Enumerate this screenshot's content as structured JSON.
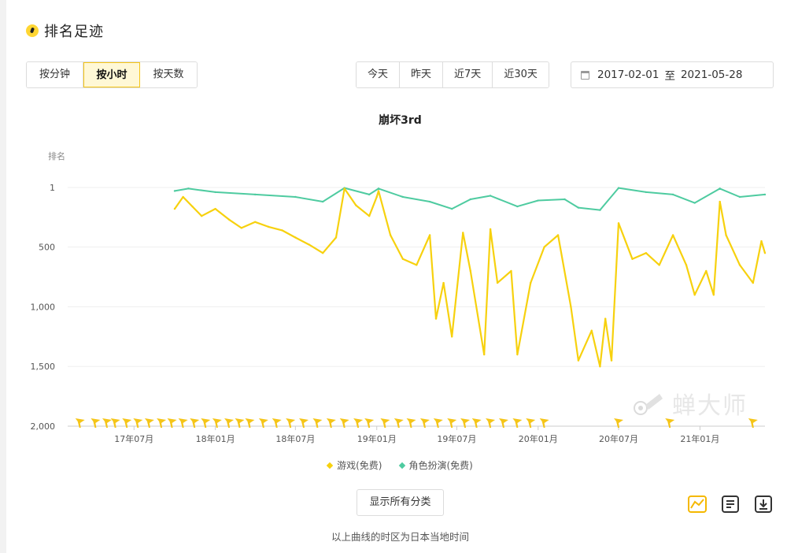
{
  "header": {
    "title": "排名足迹"
  },
  "granularity": {
    "options": [
      "按分钟",
      "按小时",
      "按天数"
    ],
    "active": 1
  },
  "quick_range": {
    "options": [
      "今天",
      "昨天",
      "近7天",
      "近30天"
    ]
  },
  "date_range": {
    "start": "2017-02-01",
    "separator": "至",
    "end": "2021-05-28"
  },
  "chart_data": {
    "type": "line",
    "title": "崩坏3rd",
    "ylabel": "排名",
    "yaxis": {
      "reversed": true,
      "ticks": [
        "1",
        "500",
        "1,000",
        "1,500",
        "2,000"
      ],
      "tick_values": [
        1,
        500,
        1000,
        1500,
        2000
      ],
      "range": [
        1,
        2000
      ]
    },
    "xaxis": {
      "ticks": [
        "17年07月",
        "18年01月",
        "18年07月",
        "19年01月",
        "19年07月",
        "20年01月",
        "20年07月",
        "21年01月"
      ],
      "tick_dates": [
        "2017-07-01",
        "2018-01-01",
        "2018-07-01",
        "2019-01-01",
        "2019-07-01",
        "2020-01-01",
        "2020-07-01",
        "2021-01-01"
      ],
      "range": [
        "2017-02-01",
        "2021-05-28"
      ]
    },
    "grid": true,
    "series": [
      {
        "name": "游戏(免费)",
        "color": "#f7d10e",
        "points": [
          [
            "2017-10-01",
            180
          ],
          [
            "2017-10-20",
            80
          ],
          [
            "2017-11-10",
            160
          ],
          [
            "2017-12-01",
            240
          ],
          [
            "2018-01-01",
            180
          ],
          [
            "2018-02-01",
            270
          ],
          [
            "2018-03-01",
            340
          ],
          [
            "2018-04-01",
            290
          ],
          [
            "2018-05-01",
            330
          ],
          [
            "2018-06-01",
            360
          ],
          [
            "2018-07-01",
            420
          ],
          [
            "2018-08-01",
            480
          ],
          [
            "2018-09-01",
            550
          ],
          [
            "2018-10-01",
            420
          ],
          [
            "2018-10-20",
            10
          ],
          [
            "2018-11-15",
            150
          ],
          [
            "2018-12-15",
            240
          ],
          [
            "2019-01-01",
            80
          ],
          [
            "2019-01-05",
            30
          ],
          [
            "2019-02-01",
            400
          ],
          [
            "2019-03-01",
            600
          ],
          [
            "2019-04-01",
            650
          ],
          [
            "2019-05-01",
            400
          ],
          [
            "2019-05-15",
            1100
          ],
          [
            "2019-06-01",
            800
          ],
          [
            "2019-06-20",
            1250
          ],
          [
            "2019-07-15",
            380
          ],
          [
            "2019-08-01",
            700
          ],
          [
            "2019-09-01",
            1400
          ],
          [
            "2019-09-15",
            350
          ],
          [
            "2019-10-01",
            800
          ],
          [
            "2019-11-01",
            700
          ],
          [
            "2019-11-15",
            1400
          ],
          [
            "2019-12-15",
            800
          ],
          [
            "2020-01-15",
            500
          ],
          [
            "2020-02-15",
            400
          ],
          [
            "2020-03-15",
            1000
          ],
          [
            "2020-04-01",
            1450
          ],
          [
            "2020-05-01",
            1200
          ],
          [
            "2020-05-20",
            1500
          ],
          [
            "2020-06-01",
            1100
          ],
          [
            "2020-06-15",
            1450
          ],
          [
            "2020-07-01",
            300
          ],
          [
            "2020-08-01",
            600
          ],
          [
            "2020-09-01",
            550
          ],
          [
            "2020-10-01",
            650
          ],
          [
            "2020-11-01",
            400
          ],
          [
            "2020-12-01",
            650
          ],
          [
            "2020-12-20",
            900
          ],
          [
            "2021-01-15",
            700
          ],
          [
            "2021-02-01",
            900
          ],
          [
            "2021-02-15",
            120
          ],
          [
            "2021-03-01",
            400
          ],
          [
            "2021-04-01",
            650
          ],
          [
            "2021-05-01",
            800
          ],
          [
            "2021-05-20",
            450
          ],
          [
            "2021-05-28",
            550
          ]
        ]
      },
      {
        "name": "角色扮演(免费)",
        "color": "#4ecba0",
        "points": [
          [
            "2017-10-01",
            30
          ],
          [
            "2017-11-01",
            10
          ],
          [
            "2018-01-01",
            40
          ],
          [
            "2018-04-01",
            60
          ],
          [
            "2018-07-01",
            80
          ],
          [
            "2018-09-01",
            120
          ],
          [
            "2018-10-20",
            5
          ],
          [
            "2018-12-15",
            60
          ],
          [
            "2019-01-05",
            10
          ],
          [
            "2019-03-01",
            80
          ],
          [
            "2019-05-01",
            120
          ],
          [
            "2019-06-20",
            180
          ],
          [
            "2019-08-01",
            100
          ],
          [
            "2019-09-15",
            70
          ],
          [
            "2019-11-15",
            160
          ],
          [
            "2020-01-01",
            110
          ],
          [
            "2020-03-01",
            100
          ],
          [
            "2020-04-01",
            170
          ],
          [
            "2020-05-20",
            190
          ],
          [
            "2020-07-01",
            5
          ],
          [
            "2020-09-01",
            40
          ],
          [
            "2020-11-01",
            60
          ],
          [
            "2020-12-20",
            130
          ],
          [
            "2021-02-15",
            10
          ],
          [
            "2021-04-01",
            80
          ],
          [
            "2021-05-28",
            60
          ]
        ]
      }
    ],
    "event_flag_dates": [
      "2017-03-01",
      "2017-04-05",
      "2017-05-01",
      "2017-05-20",
      "2017-06-15",
      "2017-07-10",
      "2017-08-05",
      "2017-09-01",
      "2017-09-25",
      "2017-10-20",
      "2017-11-15",
      "2017-12-10",
      "2018-01-05",
      "2018-02-01",
      "2018-02-25",
      "2018-03-20",
      "2018-04-20",
      "2018-05-20",
      "2018-06-20",
      "2018-07-20",
      "2018-08-20",
      "2018-09-20",
      "2018-10-20",
      "2018-11-20",
      "2018-12-15",
      "2019-01-20",
      "2019-02-20",
      "2019-03-20",
      "2019-04-20",
      "2019-05-20",
      "2019-06-20",
      "2019-07-20",
      "2019-08-15",
      "2019-09-15",
      "2019-10-15",
      "2019-11-15",
      "2019-12-15",
      "2020-01-15",
      "2020-07-01",
      "2020-10-25",
      "2021-05-01"
    ]
  },
  "watermark": {
    "text": "蝉大师"
  },
  "legend": {
    "items": [
      "游戏(免费)",
      "角色扮演(免费)"
    ]
  },
  "buttons": {
    "show_all": "显示所有分类"
  },
  "footer": {
    "note": "以上曲线的时区为日本当地时间"
  }
}
